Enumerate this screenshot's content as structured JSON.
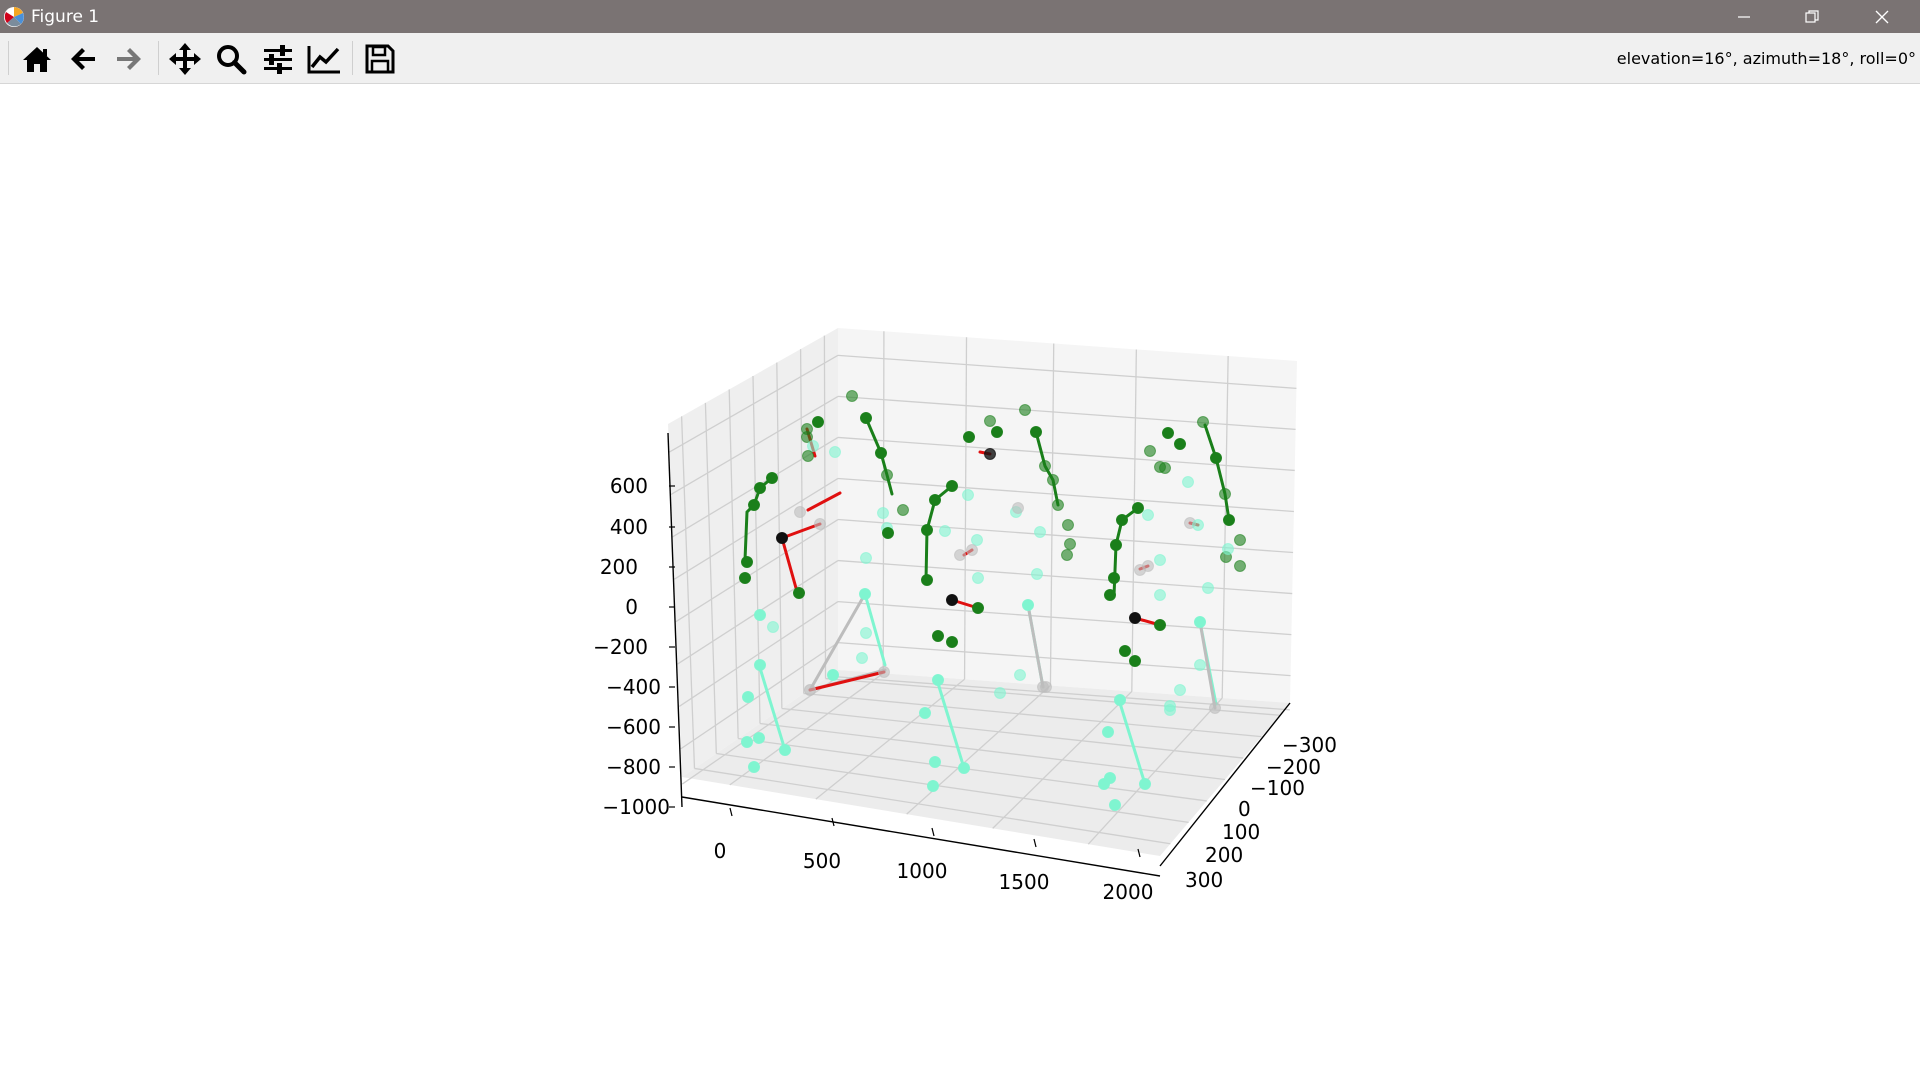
{
  "window": {
    "title": "Figure 1",
    "icon": "matplotlib-logo-icon"
  },
  "window_controls": [
    "minimize-icon",
    "restore-icon",
    "close-icon"
  ],
  "toolbar": {
    "tools": [
      {
        "name": "home",
        "icon": "home-icon"
      },
      {
        "name": "back",
        "icon": "arrow-left-icon"
      },
      {
        "name": "forward",
        "icon": "arrow-right-icon",
        "disabled": true
      },
      {
        "name": "pan",
        "icon": "move-icon"
      },
      {
        "name": "zoom",
        "icon": "zoom-icon"
      },
      {
        "name": "subplots",
        "icon": "sliders-icon"
      },
      {
        "name": "edit-axes",
        "icon": "line-chart-icon"
      },
      {
        "name": "save",
        "icon": "save-icon"
      }
    ],
    "status": "elevation=16°, azimuth=18°, roll=0°"
  },
  "chart_data": {
    "type": "scatter",
    "view": {
      "elevation": 16,
      "azimuth": 18,
      "roll": 0
    },
    "x_ticks": [
      "0",
      "500",
      "1000",
      "1500",
      "2000"
    ],
    "y_ticks": [
      "−300",
      "−200",
      "−100",
      "0",
      "100",
      "200",
      "300"
    ],
    "z_ticks": [
      "600",
      "400",
      "200",
      "0",
      "−200",
      "−400",
      "−600",
      "−800",
      "−1000"
    ],
    "xlim": [
      -200,
      2100
    ],
    "ylim": [
      -300,
      300
    ],
    "zlim": [
      -1000,
      700
    ],
    "grid": true,
    "colors": {
      "green": "#1a7f1a",
      "aqua": "#7ff5d0",
      "red": "#e01010",
      "gray": "#bdbdbd",
      "black": "#111111",
      "pane": "#f2f2f2",
      "grid": "#cfcfcf"
    }
  }
}
